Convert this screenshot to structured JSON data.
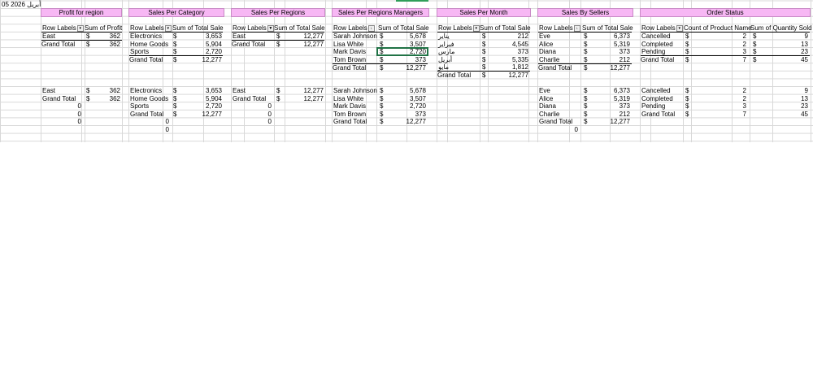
{
  "date": "05 أبريل 2026",
  "headers": {
    "profit": "Profit for region",
    "category": "Sales Per Category",
    "regions": "Sales Per Regions",
    "managers": "Sales Per Regions Managers",
    "month": "Sales Per Month",
    "sellers": "Sales By Sellers",
    "status": "Order Status"
  },
  "cols": {
    "row_labels": "Row Labels",
    "sum_profit": "Sum of Profit",
    "sum_total_sale": "Sum of Total Sale",
    "count_product": "Count of Product Name",
    "sum_qty": "Sum of Quantity Sold"
  },
  "cur": "$",
  "grand": "Grand Total",
  "profit": {
    "rows": [
      [
        "East",
        "362"
      ]
    ],
    "total": "362"
  },
  "category": {
    "rows": [
      [
        "Electronics",
        "3,653"
      ],
      [
        "Home Goods",
        "5,904"
      ],
      [
        "Sports",
        "2,720"
      ]
    ],
    "total": "12,277"
  },
  "regions": {
    "rows": [
      [
        "East",
        "12,277"
      ]
    ],
    "total": "12,277"
  },
  "managers": {
    "rows": [
      [
        "Sarah Johnson",
        "5,678"
      ],
      [
        "Lisa White",
        "3,507"
      ],
      [
        "Mark Davis",
        "2,720"
      ],
      [
        "Tom Brown",
        "373"
      ]
    ],
    "total": "12,277"
  },
  "month": {
    "rows": [
      [
        "يناير",
        "212"
      ],
      [
        "فبراير",
        "4,545"
      ],
      [
        "مارس",
        "373"
      ],
      [
        "أبريل",
        "5,335"
      ],
      [
        "مايو",
        "1,812"
      ]
    ],
    "total": "12,277"
  },
  "sellers": {
    "rows": [
      [
        "Eve",
        "6,373"
      ],
      [
        "Alice",
        "5,319"
      ],
      [
        "Diana",
        "373"
      ],
      [
        "Charlie",
        "212"
      ]
    ],
    "total": "12,277"
  },
  "status": {
    "rows": [
      [
        "Cancelled",
        "2",
        "9"
      ],
      [
        "Completed",
        "2",
        "13"
      ],
      [
        "Pending",
        "3",
        "23"
      ]
    ],
    "total_count": "7",
    "total_qty": "45"
  },
  "zero": "0"
}
